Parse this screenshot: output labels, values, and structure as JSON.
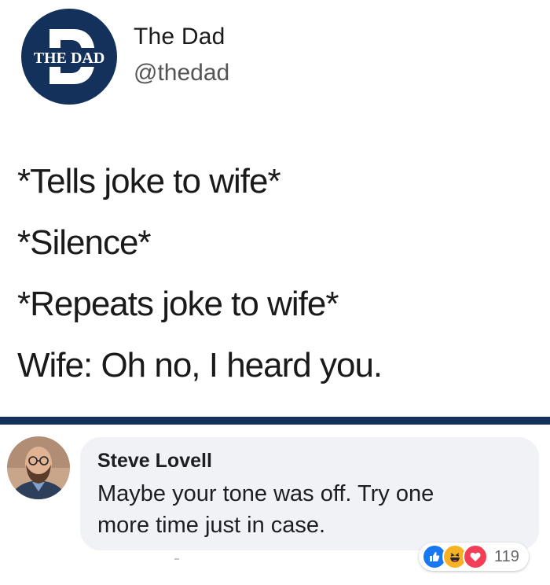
{
  "tweet": {
    "logo_text": "THE DAD",
    "name": "The Dad",
    "handle": "@thedad",
    "lines": [
      "*Tells joke to wife*",
      "*Silence*",
      "*Repeats joke to wife*",
      "Wife: Oh no, I heard you."
    ]
  },
  "comment": {
    "author": "Steve Lovell",
    "text": "Maybe your tone was off. Try one more time just in case.",
    "reactions": {
      "icons": [
        "like-icon",
        "haha-icon",
        "love-icon"
      ],
      "count": "119"
    }
  },
  "colors": {
    "brand_navy": "#13315a",
    "bubble_bg": "#f0f2f5",
    "like_blue": "#1877f2",
    "haha_yellow": "#f7b125",
    "love_red": "#f33e58"
  }
}
